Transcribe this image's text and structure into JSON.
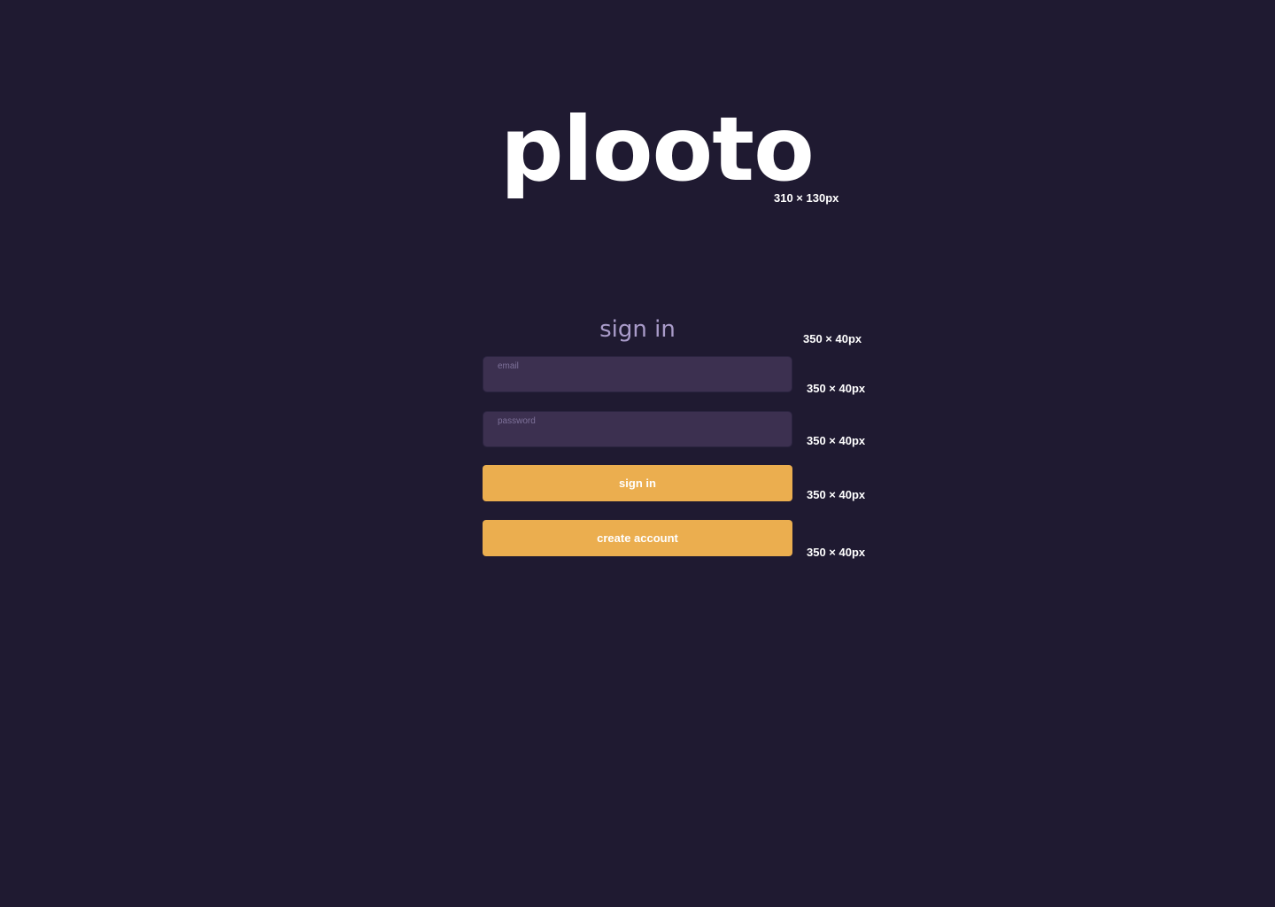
{
  "logo": {
    "text": "plooto",
    "dimension_label": "310 × 130px"
  },
  "sign_in_form": {
    "heading": "sign in",
    "heading_dimension_label": "350 × 40px",
    "email": {
      "placeholder": "email",
      "value": "",
      "dimension_label": "350 × 40px"
    },
    "password": {
      "placeholder": "password",
      "value": "",
      "dimension_label": "350 × 40px"
    },
    "sign_in_button": {
      "label": "sign in",
      "dimension_label": "350 × 40px"
    },
    "create_account_button": {
      "label": "create account",
      "dimension_label": "350 × 40px"
    }
  },
  "colors": {
    "background": "#1f1a31",
    "logo_text": "#ffffff",
    "heading_text": "#a99bc9",
    "input_background": "#3c3050",
    "placeholder_text": "#7d7199",
    "button_background": "#ebae4f",
    "button_text": "#ffffff"
  }
}
